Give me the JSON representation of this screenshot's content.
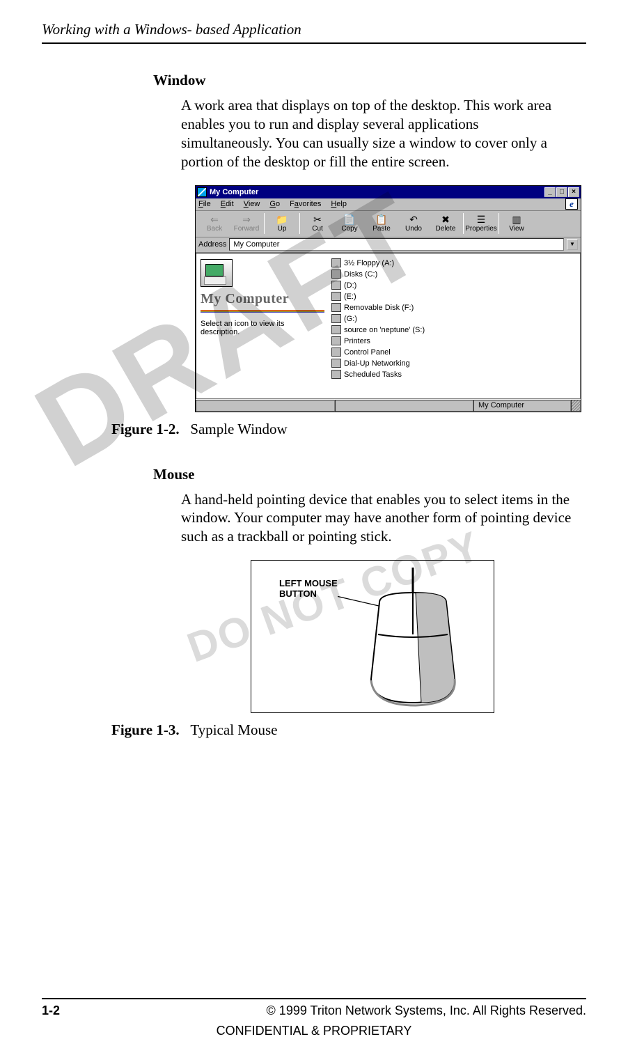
{
  "header": {
    "running": "Working with a Windows- based Application"
  },
  "watermarks": {
    "big": "DRAFT",
    "small": "DO NOT COPY"
  },
  "sections": {
    "window": {
      "term": "Window",
      "para": "A work area that displays on top of the desktop. This work area enables you to run and display several applications simultaneously. You can usually size a window to cover only a portion of the desktop or fill the entire screen."
    },
    "mouse": {
      "term": "Mouse",
      "para": "A hand-held  pointing device that enables you to select items in the window. Your computer may have another form of pointing device such as a trackball or pointing stick."
    }
  },
  "captions": {
    "fig1_bold": "Figure 1-2.",
    "fig1_rest": "Sample Window",
    "fig2_bold": "Figure 1-3.",
    "fig2_rest": "Typical Mouse"
  },
  "mycomputer": {
    "title": "My Computer",
    "menus": [
      "File",
      "Edit",
      "View",
      "Go",
      "Favorites",
      "Help"
    ],
    "toolbar": [
      "Back",
      "Forward",
      "Up",
      "Cut",
      "Copy",
      "Paste",
      "Undo",
      "Delete",
      "Properties",
      "View"
    ],
    "toolbar_disabled": [
      true,
      true,
      false,
      false,
      false,
      false,
      false,
      false,
      false,
      false
    ],
    "toolbar_separators_after": [
      1,
      2,
      7,
      8
    ],
    "address_label": "Address",
    "address_value": "My Computer",
    "left_heading": "My Computer",
    "left_hint": "Select an icon to view its description.",
    "items": [
      "3½ Floppy (A:)",
      "Disks (C:)",
      "(D:)",
      "(E:)",
      "Removable Disk (F:)",
      "(G:)",
      "source on 'neptune' (S:)",
      "Printers",
      "Control Panel",
      "Dial-Up Networking",
      "Scheduled Tasks"
    ],
    "status_right": "My Computer"
  },
  "mouse_diagram": {
    "label_l1": "LEFT MOUSE",
    "label_l2": "BUTTON"
  },
  "footer": {
    "page": "1-2",
    "copyright": "© 1999 Triton Network Systems, Inc. All Rights Reserved.",
    "confidential": "CONFIDENTIAL & PROPRIETARY"
  }
}
